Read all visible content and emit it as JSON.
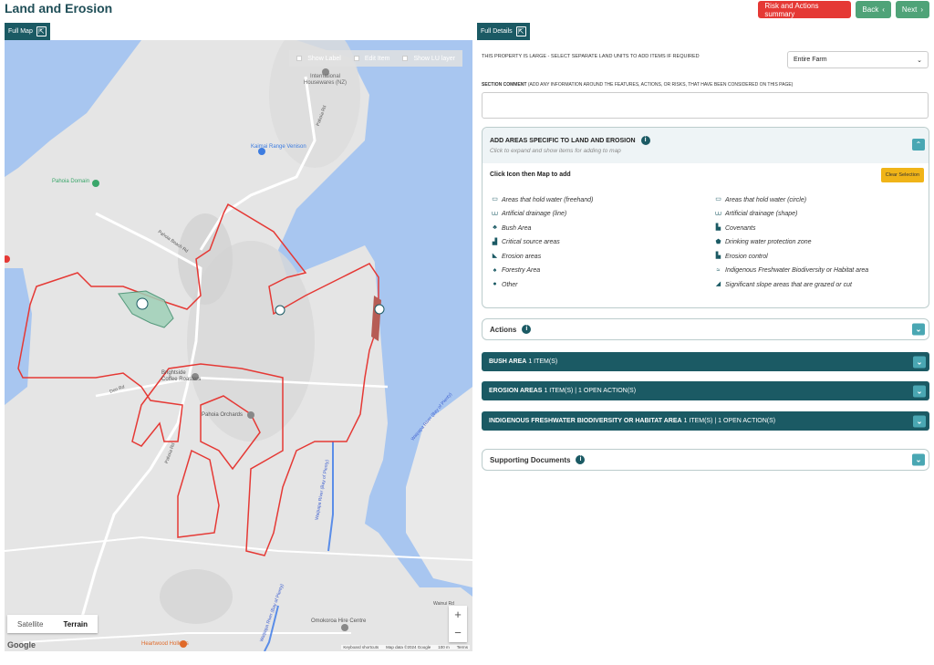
{
  "page": {
    "title": "Land and Erosion"
  },
  "header": {
    "risk_label": "Risk and Actions summary",
    "back_label": "Back",
    "next_label": "Next"
  },
  "tabs": {
    "map": "Full Map",
    "details": "Full Details"
  },
  "map": {
    "toolbar": {
      "show_label": "Show Label",
      "edit_item": "Edit Item",
      "show_lu": "Show LU layer"
    },
    "places": {
      "intl": "International",
      "intl2": "Housewares (NZ)",
      "kaimai": "Kaimai Range Venison",
      "domain": "Pahoia Domain",
      "brightside": "Brightside",
      "brightside2": "Coffee Roasters",
      "orchards": "Pahoia Orchards",
      "omokoroa": "Omokoroa Hire Centre",
      "heartwood": "Heartwood Hollows",
      "pahoia_beach_rd": "Pahoia Beach Rd",
      "don_rd": "Don Rd",
      "wairoa": "Wairoa River (Bay of Plenty)",
      "waipapa": "Waipapa River (Bay of Plenty)",
      "pahoia_rd": "Pahoia Rd",
      "wainui": "Wainui Rd"
    },
    "type_satellite": "Satellite",
    "type_terrain": "Terrain",
    "zoom_in": "+",
    "zoom_out": "−",
    "google": "Google",
    "attrib": {
      "shortcuts": "Keyboard shortcuts",
      "data": "Map data ©2024 Google",
      "scale": "100 m",
      "terms": "Terms"
    }
  },
  "panel": {
    "property_note": "THIS PROPERTY IS LARGE - SELECT SEPARATE LAND UNITS TO ADD ITEMS IF REQUIRED",
    "unit_select": "Entire Farm",
    "comment_label": "SECTION COMMENT",
    "comment_hint": "(ADD ANY INFORMATION AROUND THE FEATURES, ACTIONS, OR RISKS, THAT HAVE BEEN CONSIDERED ON THIS PAGE)",
    "add": {
      "title": "ADD AREAS SPECIFIC TO LAND AND EROSION",
      "subtitle": "Click to expand and show items for adding to map",
      "click_hint": "Click Icon then Map to add",
      "clear": "Clear Selection",
      "items": [
        {
          "label": "Areas that hold water (freehand)",
          "icon": "water-freehand-icon",
          "glyph": "▭"
        },
        {
          "label": "Areas that hold water (circle)",
          "icon": "water-circle-icon",
          "glyph": "▭"
        },
        {
          "label": "Artificial drainage (line)",
          "icon": "drainage-line-icon",
          "glyph": "⩊"
        },
        {
          "label": "Artificial drainage (shape)",
          "icon": "drainage-shape-icon",
          "glyph": "⩊"
        },
        {
          "label": "Bush Area",
          "icon": "bush-icon",
          "glyph": "♣"
        },
        {
          "label": "Covenants",
          "icon": "covenant-icon",
          "glyph": "▙"
        },
        {
          "label": "Critical source areas",
          "icon": "critical-source-icon",
          "glyph": "▟"
        },
        {
          "label": "Drinking water protection zone",
          "icon": "drinking-water-icon",
          "glyph": "⬟"
        },
        {
          "label": "Erosion areas",
          "icon": "erosion-area-icon",
          "glyph": "◣"
        },
        {
          "label": "Erosion control",
          "icon": "erosion-control-icon",
          "glyph": "▙"
        },
        {
          "label": "Forestry Area",
          "icon": "forestry-icon",
          "glyph": "♠"
        },
        {
          "label": "Indigenous Freshwater Biodiversity or Habitat area",
          "icon": "biodiversity-icon",
          "glyph": "≈"
        },
        {
          "label": "Other",
          "icon": "other-icon",
          "glyph": "●"
        },
        {
          "label": "Significant slope areas that are grazed or cut",
          "icon": "slope-icon",
          "glyph": "◢"
        }
      ]
    },
    "actions": "Actions",
    "bush": {
      "title": "BUSH AREA",
      "count": "1 ITEM(S)"
    },
    "erosion": {
      "title": "EROSION AREAS",
      "count": "1 ITEM(S) | 1 OPEN ACTION(S)"
    },
    "indigenous": {
      "title": "INDIGENOUS FRESHWATER BIODIVERSITY OR HABITAT AREA",
      "count": "1 ITEM(S) | 1 OPEN ACTION(S)"
    },
    "docs": "Supporting Documents"
  }
}
